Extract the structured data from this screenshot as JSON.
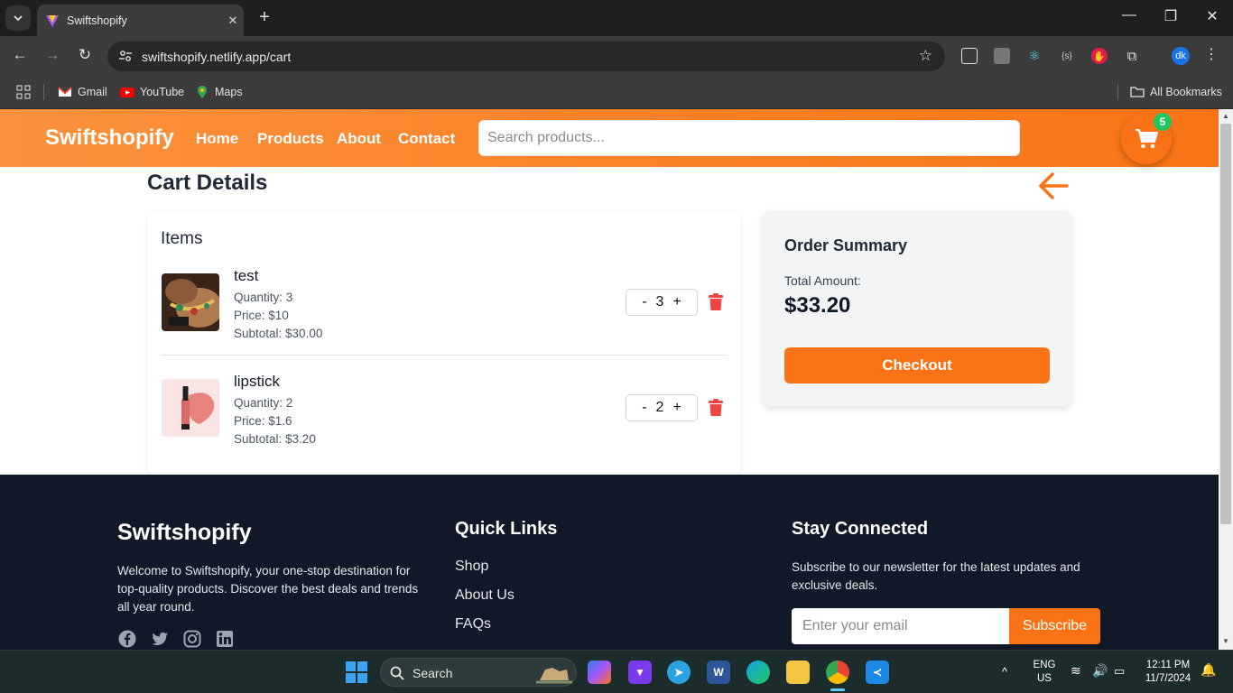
{
  "browser": {
    "tab_title": "Swiftshopify",
    "url": "swiftshopify.netlify.app/cart",
    "profile_initials": "dk",
    "bookmarks": [
      "Gmail",
      "YouTube",
      "Maps"
    ],
    "all_bookmarks": "All Bookmarks"
  },
  "header": {
    "brand": "Swiftshopify",
    "nav": [
      "Home",
      "Products",
      "About",
      "Contact"
    ],
    "search_placeholder": "Search products...",
    "cart_count": "5"
  },
  "cart": {
    "title": "Cart Details",
    "items_heading": "Items",
    "items": [
      {
        "name": "test",
        "quantity": "Quantity: 3",
        "price": "Price: $10",
        "subtotal": "Subtotal: $30.00",
        "qty_value": "3",
        "image": "jewelry-photo"
      },
      {
        "name": "lipstick",
        "quantity": "Quantity: 2",
        "price": "Price: $1.6",
        "subtotal": "Subtotal: $3.20",
        "qty_value": "2",
        "image": "lipstick-photo"
      }
    ],
    "minus": "-",
    "plus": "+"
  },
  "summary": {
    "title": "Order Summary",
    "total_label": "Total Amount:",
    "total_value": "$33.20",
    "checkout": "Checkout"
  },
  "footer": {
    "brand": "Swiftshopify",
    "about_text": "Welcome to Swiftshopify, your one-stop destination for top-quality products. Discover the best deals and trends all year round.",
    "quick_links_heading": "Quick Links",
    "quick_links": [
      "Shop",
      "About Us",
      "FAQs"
    ],
    "connect_heading": "Stay Connected",
    "connect_text": "Subscribe to our newsletter for the latest updates and exclusive deals.",
    "email_placeholder": "Enter your email",
    "subscribe": "Subscribe",
    "social_icons": [
      "facebook-icon",
      "twitter-icon",
      "instagram-icon",
      "linkedin-icon"
    ]
  },
  "taskbar": {
    "search_label": "Search",
    "lang_primary": "ENG",
    "lang_secondary": "US",
    "time": "12:11 PM",
    "date": "11/7/2024"
  },
  "colors": {
    "accent": "#f97316",
    "footer_bg": "#111827",
    "badge": "#22c55e",
    "delete": "#ef4444"
  }
}
